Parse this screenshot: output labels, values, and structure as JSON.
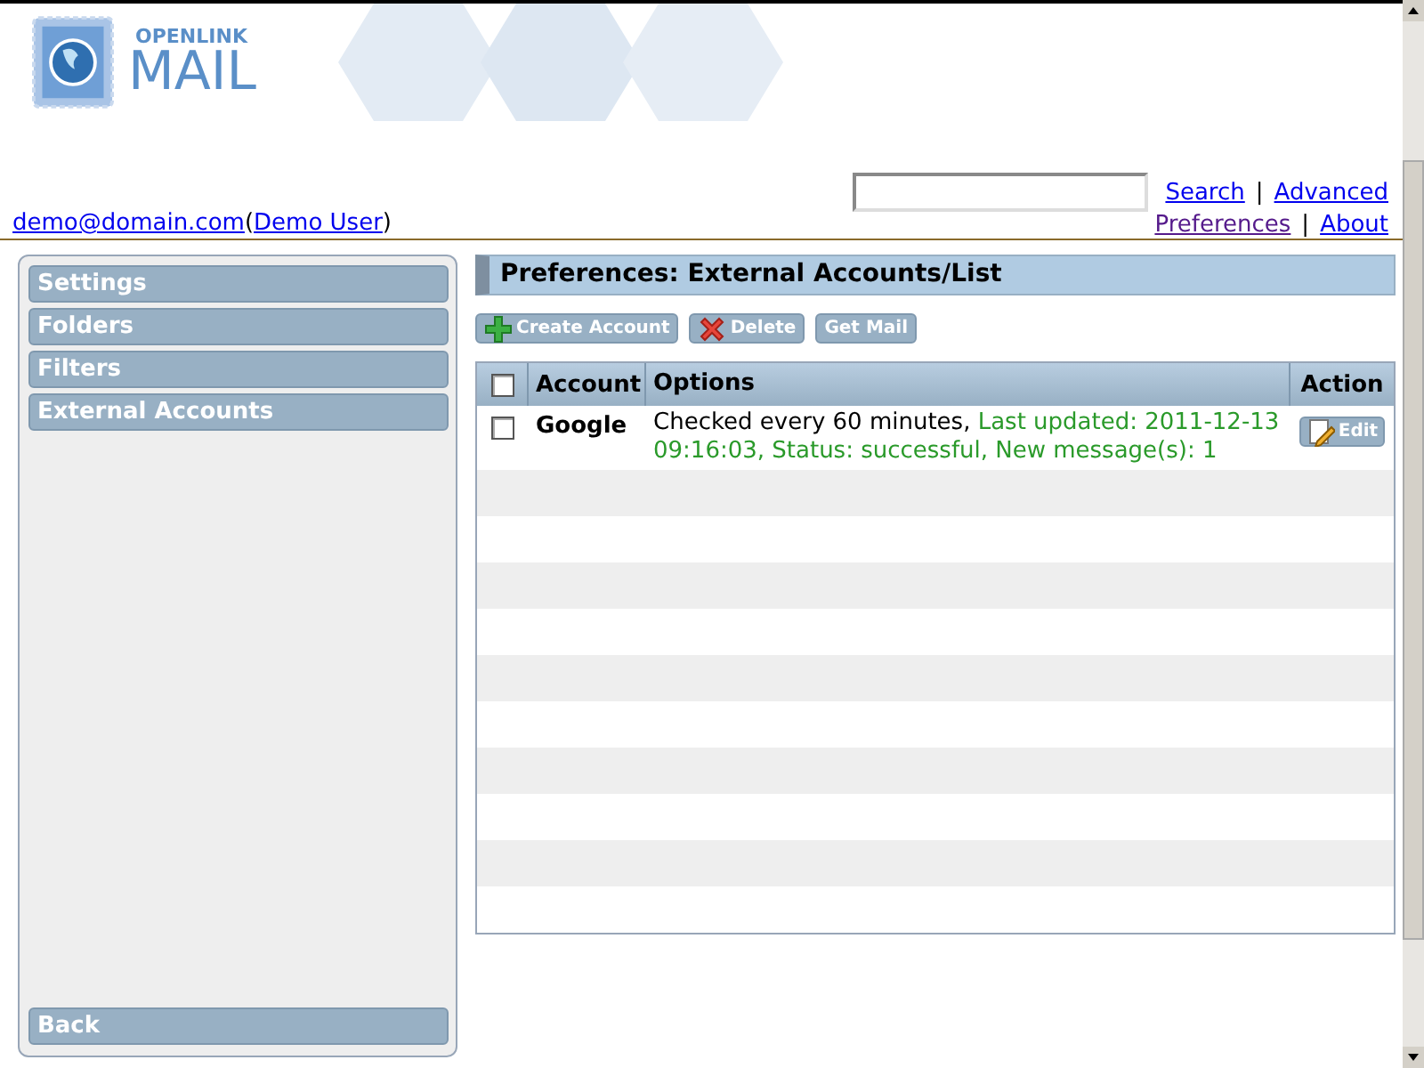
{
  "logo": {
    "small": "OPENLINK",
    "big": "MAIL"
  },
  "user": {
    "email": "demo@domain.com",
    "open": "(",
    "name": "Demo User",
    "close": ")"
  },
  "top_links": [
    {
      "label": "Search",
      "visited": false
    },
    {
      "label": "Advanced",
      "visited": false
    },
    {
      "label": "Preferences",
      "visited": true
    },
    {
      "label": "About",
      "visited": false
    }
  ],
  "link_separators": [
    "|",
    "|"
  ],
  "sidebar": {
    "items": [
      {
        "label": "Settings"
      },
      {
        "label": "Folders"
      },
      {
        "label": "Filters"
      },
      {
        "label": "External Accounts"
      }
    ],
    "back": "Back"
  },
  "title": "Preferences: External Accounts/List",
  "toolbar": [
    {
      "label": "Create Account",
      "kind": "create"
    },
    {
      "label": "Delete",
      "kind": "delete"
    },
    {
      "label": "Get Mail",
      "kind": "fetch"
    }
  ],
  "table": {
    "columns": [
      "Account",
      "Options",
      "Action"
    ],
    "all_checked": false,
    "rows": [
      {
        "checked": false,
        "account": "Google",
        "options": "Checked every 60 minutes,",
        "status": "Last updated: 2011-12-13 09:16:03, Status: successful, New message(s): 1",
        "action": "Edit"
      }
    ]
  }
}
